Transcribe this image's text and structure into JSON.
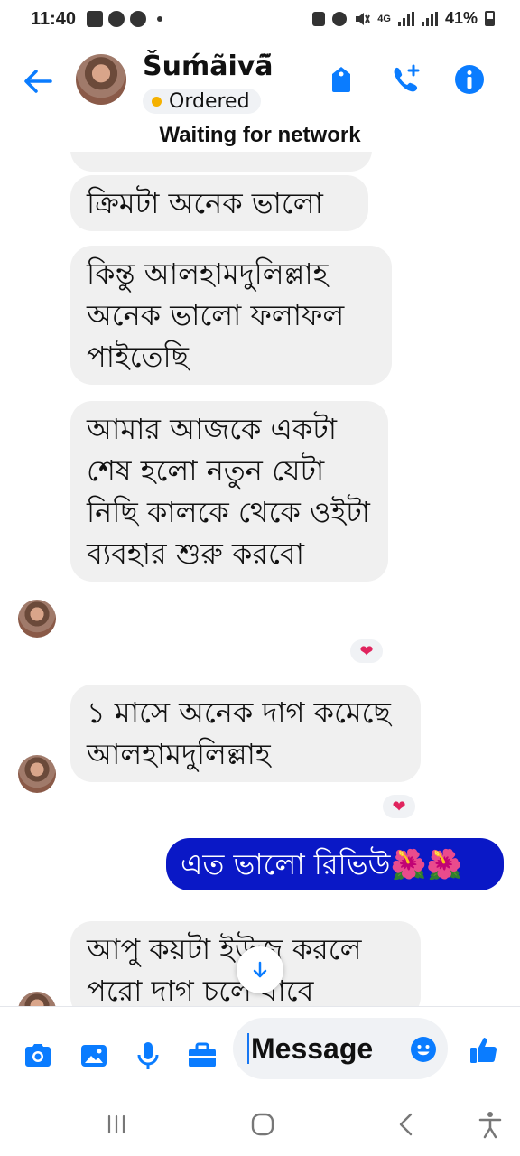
{
  "status_bar": {
    "time": "11:40",
    "battery": "41%",
    "network": "4G"
  },
  "header": {
    "contact_name": "Šuḿãivã̃",
    "status_label": "Ordered",
    "network_banner": "Waiting for network"
  },
  "messages": [
    {
      "dir": "in",
      "text": "ক্রিমটা অনেক ভালো"
    },
    {
      "dir": "in",
      "text": "কিন্তু আলহামদুলিল্লাহ অনেক ভালো ফলাফল পাইতেছি"
    },
    {
      "dir": "in",
      "text": "আমার আজকে একটা শেষ হলো নতুন যেটা নিছি কালকে থেকে ওইটা ব্যবহার শুরু করবো",
      "reaction": "❤"
    },
    {
      "dir": "in",
      "text": "১ মাসে অনেক দাগ কমেছে আলহামদুলিল্লাহ",
      "reaction": "❤"
    },
    {
      "dir": "out",
      "text": "এত ভালো রিভিউ🌺🌺"
    },
    {
      "dir": "in",
      "text": "আপু কয়টা ইউজ করলে পরো দাগ চলে যাবে"
    }
  ],
  "composer": {
    "placeholder": "Message"
  },
  "colors": {
    "accent": "#0a7cff",
    "outgoing_bubble": "#0a18c6",
    "incoming_bubble": "#f0f0f0"
  }
}
